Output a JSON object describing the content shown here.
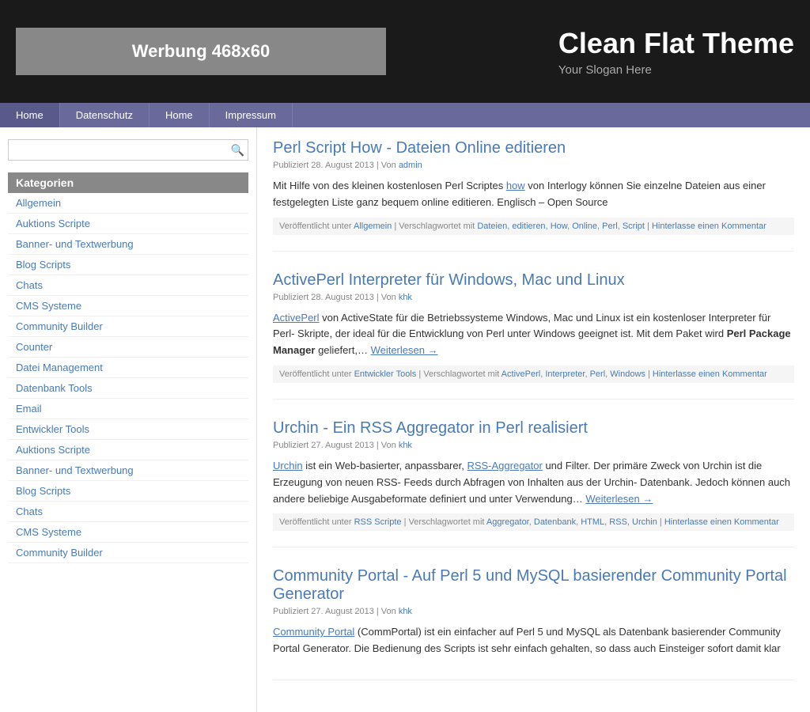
{
  "header": {
    "ad_text": "Werbung 468x60",
    "site_title": "Clean Flat Theme",
    "site_slogan": "Your Slogan Here"
  },
  "nav": {
    "items": [
      {
        "label": "Home"
      },
      {
        "label": "Datenschutz"
      },
      {
        "label": "Home"
      },
      {
        "label": "Impressum"
      }
    ]
  },
  "sidebar": {
    "search_placeholder": "",
    "kategorien_label": "Kategorien",
    "links": [
      {
        "label": "Allgemein"
      },
      {
        "label": "Auktions Scripte"
      },
      {
        "label": "Banner- und Textwerbung"
      },
      {
        "label": "Blog Scripts"
      },
      {
        "label": "Chats"
      },
      {
        "label": "CMS Systeme"
      },
      {
        "label": "Community Builder"
      },
      {
        "label": "Counter"
      },
      {
        "label": "Datei Management"
      },
      {
        "label": "Datenbank Tools"
      },
      {
        "label": "Email"
      },
      {
        "label": "Entwickler Tools"
      },
      {
        "label": "Auktions Scripte"
      },
      {
        "label": "Banner- und Textwerbung"
      },
      {
        "label": "Blog Scripts"
      },
      {
        "label": "Chats"
      },
      {
        "label": "CMS Systeme"
      },
      {
        "label": "Community Builder"
      }
    ]
  },
  "posts": [
    {
      "title": "Perl Script How - Dateien Online editieren",
      "meta": "Publiziert 28. August 2013 | Von admin",
      "excerpt_before": "Mit Hilfe von des kleinen kostenlosen Perl Scriptes ",
      "excerpt_link_text": "how",
      "excerpt_after": " von Interlogy können Sie einzelne Dateien aus einer festgelegten Liste ganz bequem online editieren. Englisch – Open Source",
      "footer": "Veröffentlicht unter Allgemein | Verschlagwortet mit Dateien, editieren, How, Online, Perl, Script | Hinterlasse einen Kommentar",
      "has_weiterlesen": false
    },
    {
      "title": "ActivePerl Interpreter für Windows, Mac und Linux",
      "meta": "Publiziert 28. August 2013 | Von khk",
      "excerpt_before": "",
      "excerpt_link_text": "ActivePerl",
      "excerpt_after": " von ActiveState für die Betriebssysteme Windows, Mac und Linux ist ein kostenloser Interpreter für Perl- Skripte, der ideal für die Entwicklung von Perl unter Windows geeignet ist. Mit dem Paket wird ",
      "excerpt_bold": "Perl Package Manager",
      "excerpt_end": " geliefert,… ",
      "weiterlesen_label": "Weiterlesen →",
      "footer": "Veröffentlicht unter Entwickler Tools | Verschlagwortet mit ActivePerl, Interpreter, Perl, Windows | Hinterlasse einen Kommentar",
      "has_weiterlesen": true
    },
    {
      "title": "Urchin - Ein RSS Aggregator in Perl realisiert",
      "meta": "Publiziert 27. August 2013 | Von khk",
      "excerpt_before": "",
      "excerpt_link_text": "Urchin",
      "excerpt_link2_text": "RSS-Aggregator",
      "excerpt_mid": " ist ein Web-basierter, anpassbarer, ",
      "excerpt_after": " und Filter. Der primäre Zweck von Urchin ist die Erzeugung von neuen RSS- Feeds durch Abfragen von Inhalten aus der Urchin- Datenbank. Jedoch können auch andere beliebige Ausgabeformate definiert und unter Verwendung… ",
      "weiterlesen_label": "Weiterlesen →",
      "footer": "Veröffentlicht unter RSS Scripte | Verschlagwortet mit Aggregator, Datenbank, HTML, RSS, Urchin | Hinterlasse einen Kommentar",
      "has_weiterlesen": true
    },
    {
      "title": "Community Portal - Auf Perl 5 und MySQL basierender Community Portal Generator",
      "meta": "Publiziert 27. August 2013 | Von khk",
      "excerpt_before": "",
      "excerpt_link_text": "Community Portal",
      "excerpt_after": " (CommPortal) ist ein einfacher auf Perl 5 und MySQL als Datenbank basierender Community Portal Generator. Die Bedienung des Scripts ist sehr einfach gehalten, so dass auch Einsteiger sofort damit klar",
      "footer": "",
      "has_weiterlesen": false,
      "truncated": true
    }
  ]
}
